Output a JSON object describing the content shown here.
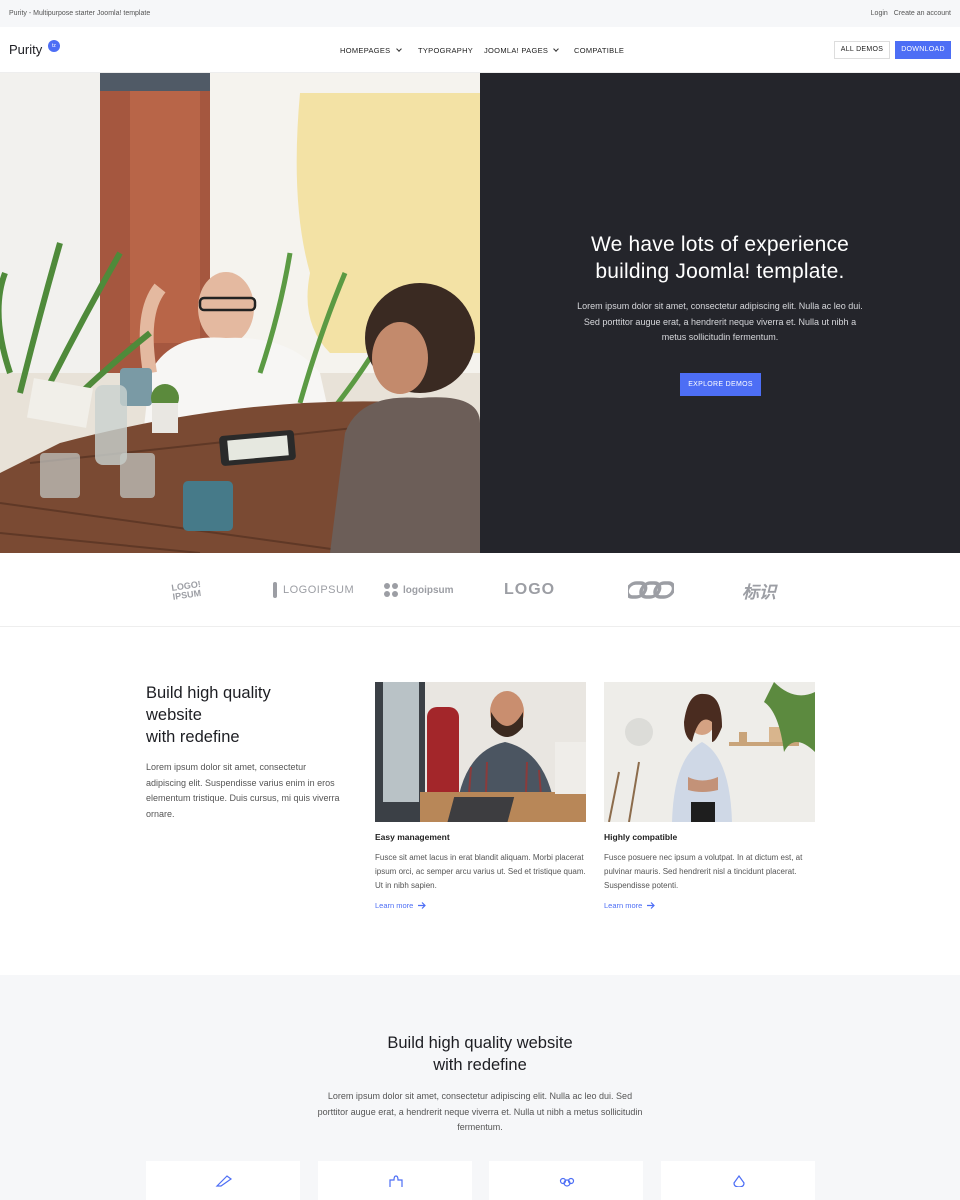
{
  "topbar": {
    "tagline": "Purity - Multipurpose starter Joomla! template",
    "login": "Login",
    "create_account": "Create an account"
  },
  "brand": {
    "name": "Purity",
    "badge": "tz",
    "accent": "#4d6ef5",
    "dark": "#24252b"
  },
  "nav": {
    "items": [
      {
        "label": "HOMEPAGES",
        "has_dropdown": true
      },
      {
        "label": "TYPOGRAPHY",
        "has_dropdown": false
      },
      {
        "label": "JOOMLA! PAGES",
        "has_dropdown": true
      },
      {
        "label": "COMPATIBLE",
        "has_dropdown": false
      }
    ],
    "all_demos": "ALL DEMOS",
    "download": "DOWNLOAD"
  },
  "hero": {
    "title_line1": "We have lots of experience",
    "title_line2": "building Joomla! template.",
    "text": "Lorem ipsum dolor sit amet, consectetur adipiscing elit. Nulla ac leo dui. Sed porttitor augue erat, a hendrerit neque viverra et. Nulla ut nibh a metus sollicitudin fermentum.",
    "button": "EXPLORE DEMOS"
  },
  "logos": {
    "items": [
      "LOGO! IPSUM",
      "LOGOIPSUM",
      "logoipsum",
      "LOGO",
      "",
      "标识"
    ]
  },
  "features": {
    "title_line1": "Build high quality",
    "title_line2": "website",
    "title_line3": "with redefine",
    "text": "Lorem ipsum dolor sit amet, consectetur adipiscing elit. Suspendisse varius enim in eros elementum tristique. Duis cursus, mi quis viverra ornare.",
    "cards": [
      {
        "title": "Easy management",
        "text": "Fusce sit amet lacus in erat blandit aliquam. Morbi placerat ipsum orci, ac semper arcu varius ut. Sed et tristique quam. Ut in nibh sapien.",
        "link": "Learn more"
      },
      {
        "title": "Highly compatible",
        "text": "Fusce posuere nec ipsum a volutpat. In at dictum est, at pulvinar mauris. Sed hendrerit nisl a tincidunt placerat. Suspendisse potenti.",
        "link": "Learn more"
      }
    ]
  },
  "section2": {
    "title_line1": "Build high quality website",
    "title_line2": "with redefine",
    "text": "Lorem ipsum dolor sit amet, consectetur adipiscing elit. Nulla ac leo dui. Sed porttitor augue erat, a hendrerit neque viverra et. Nulla ut nibh a metus sollicitudin fermentum."
  }
}
